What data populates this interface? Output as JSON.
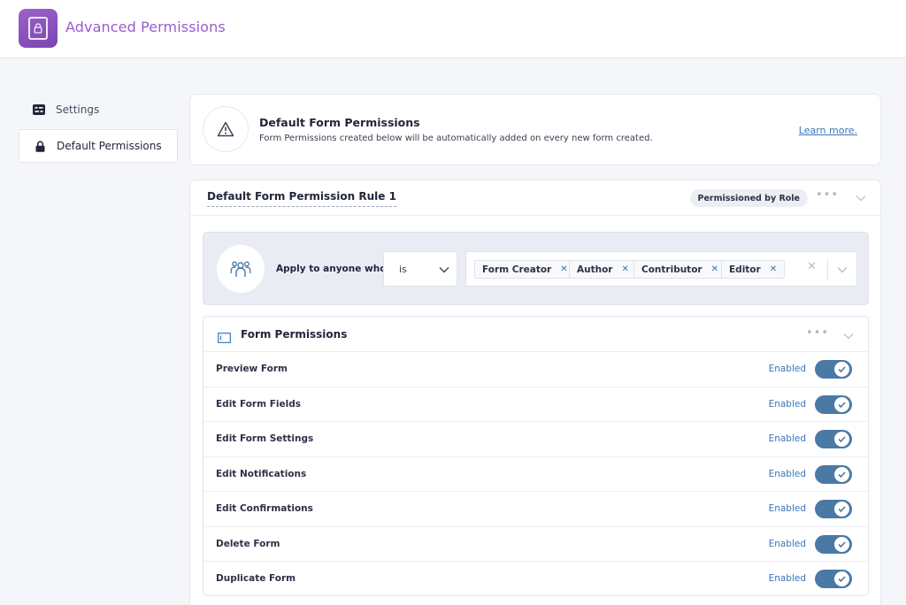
{
  "app": {
    "title": "Advanced Permissions"
  },
  "sidebar": {
    "items": [
      {
        "label": "Settings",
        "icon": "settings-grid-icon"
      },
      {
        "label": "Default Permissions",
        "icon": "lock-icon"
      }
    ]
  },
  "info": {
    "title": "Default Form Permissions",
    "description": "Form Permissions created below will be automatically added on every new form created.",
    "link": "Learn more."
  },
  "rule": {
    "title": "Default Form Permission Rule 1",
    "badge": "Permissioned by Role",
    "apply_label": "Apply to anyone who",
    "condition": "is",
    "roles": [
      "Form Creator",
      "Author",
      "Contributor",
      "Editor"
    ]
  },
  "form_permissions": {
    "title": "Form Permissions",
    "rows": [
      {
        "label": "Preview Form",
        "status": "Enabled",
        "on": true
      },
      {
        "label": "Edit Form Fields",
        "status": "Enabled",
        "on": true
      },
      {
        "label": "Edit Form Settings",
        "status": "Enabled",
        "on": true
      },
      {
        "label": "Edit Notifications",
        "status": "Enabled",
        "on": true
      },
      {
        "label": "Edit Confirmations",
        "status": "Enabled",
        "on": true
      },
      {
        "label": "Delete Form",
        "status": "Enabled",
        "on": true
      },
      {
        "label": "Duplicate Form",
        "status": "Enabled",
        "on": true
      }
    ]
  },
  "colors": {
    "brand": "#9a5cd0",
    "link": "#3a76b8",
    "toggle_on": "#4a79a5"
  }
}
